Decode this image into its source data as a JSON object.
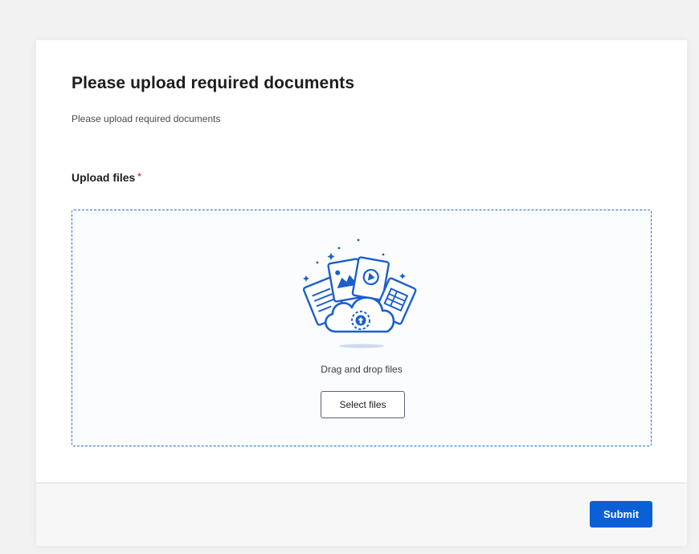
{
  "form": {
    "title": "Please upload required documents",
    "description": "Please upload required documents"
  },
  "upload": {
    "label": "Upload files",
    "required_marker": "*",
    "drop_text": "Drag and drop files",
    "select_label": "Select files",
    "illustration_icon": "cloud-upload-documents-icon"
  },
  "footer": {
    "submit_label": "Submit"
  },
  "colors": {
    "accent": "#0b5fd7",
    "dropzone_border": "#1f6fd1",
    "required": "#d0344a"
  }
}
